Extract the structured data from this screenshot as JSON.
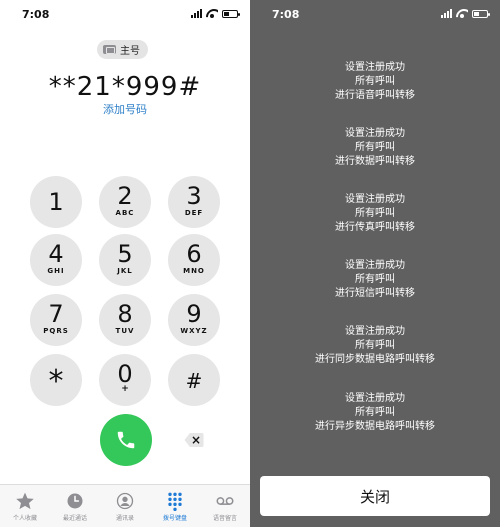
{
  "status": {
    "time": "7:08"
  },
  "dialer": {
    "sim_label": "主号",
    "number": "**21*999#",
    "add_number": "添加号码",
    "keys": [
      {
        "digit": "1",
        "letters": ""
      },
      {
        "digit": "2",
        "letters": "ABC"
      },
      {
        "digit": "3",
        "letters": "DEF"
      },
      {
        "digit": "4",
        "letters": "GHI"
      },
      {
        "digit": "5",
        "letters": "JKL"
      },
      {
        "digit": "6",
        "letters": "MNO"
      },
      {
        "digit": "7",
        "letters": "PQRS"
      },
      {
        "digit": "8",
        "letters": "TUV"
      },
      {
        "digit": "9",
        "letters": "WXYZ"
      },
      {
        "digit": "*",
        "letters": ""
      },
      {
        "digit": "0",
        "letters": "+"
      },
      {
        "digit": "#",
        "letters": ""
      }
    ],
    "delete_glyph": "×",
    "call_color": "#34c759"
  },
  "tabbar": {
    "items": [
      {
        "label": "个人收藏",
        "icon": "star-icon"
      },
      {
        "label": "最近通话",
        "icon": "clock-icon"
      },
      {
        "label": "通讯录",
        "icon": "contact-icon"
      },
      {
        "label": "拨号键盘",
        "icon": "keypad-icon",
        "active": true
      },
      {
        "label": "语音留言",
        "icon": "voicemail-icon"
      }
    ],
    "active_color": "#1f7bd6"
  },
  "results": {
    "messages": [
      {
        "line1": "设置注册成功",
        "line2": "所有呼叫",
        "line3": "进行语音呼叫转移"
      },
      {
        "line1": "设置注册成功",
        "line2": "所有呼叫",
        "line3": "进行数据呼叫转移"
      },
      {
        "line1": "设置注册成功",
        "line2": "所有呼叫",
        "line3": "进行传真呼叫转移"
      },
      {
        "line1": "设置注册成功",
        "line2": "所有呼叫",
        "line3": "进行短信呼叫转移"
      },
      {
        "line1": "设置注册成功",
        "line2": "所有呼叫",
        "line3": "进行同步数据电路呼叫转移"
      },
      {
        "line1": "设置注册成功",
        "line2": "所有呼叫",
        "line3": "进行异步数据电路呼叫转移"
      }
    ],
    "close_label": "关闭",
    "background": "#606060"
  }
}
